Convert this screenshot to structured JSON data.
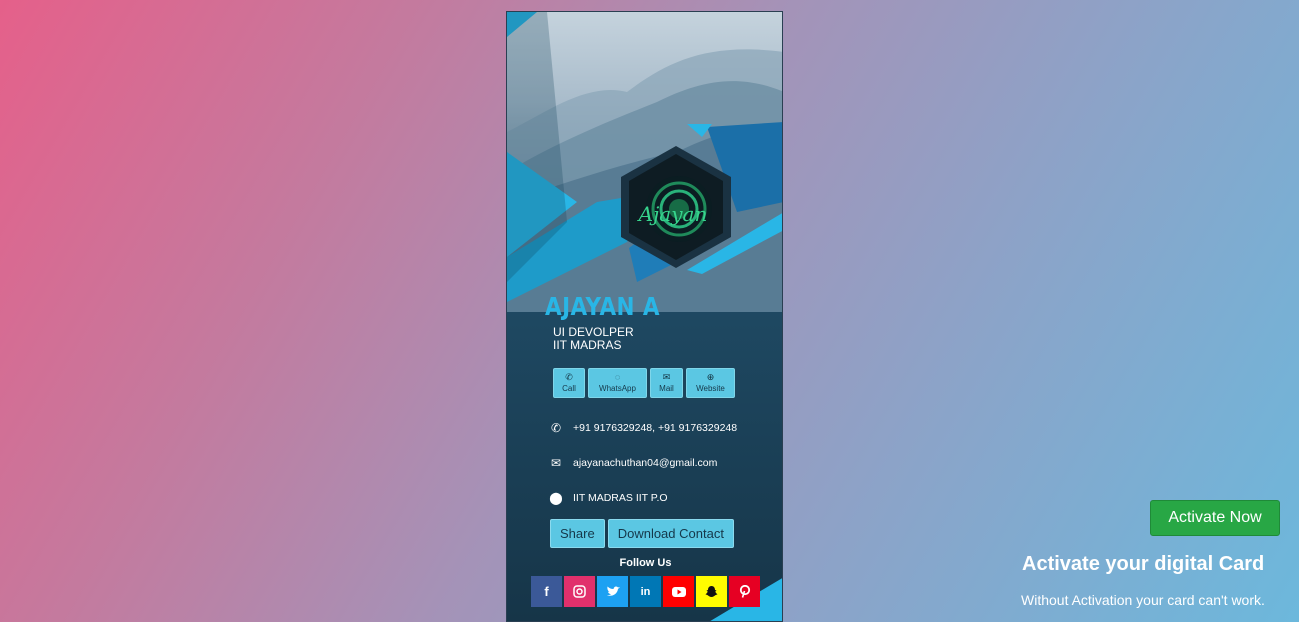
{
  "card": {
    "logo_text": "Ajayan",
    "name": "AJAYAN A",
    "role_line1": "UI DEVOLPER",
    "role_line2": "IIT MADRAS",
    "quick_buttons": [
      {
        "label": "Call",
        "icon": "phone-icon"
      },
      {
        "label": "WhatsApp",
        "icon": "whatsapp-icon"
      },
      {
        "label": "Mail",
        "icon": "mail-icon"
      },
      {
        "label": "Website",
        "icon": "globe-icon"
      }
    ],
    "phone": "+91 9176329248, +91 9176329248",
    "email": "ajayanachuthan04@gmail.com",
    "address": "IIT MADRAS IIT P.O",
    "share_label": "Share",
    "download_label": "Download Contact",
    "follow_label": "Follow Us",
    "socials": [
      {
        "name": "facebook",
        "glyph": "f",
        "color": "#3b5998"
      },
      {
        "name": "instagram",
        "glyph": "◎",
        "color": "#e1306c"
      },
      {
        "name": "twitter",
        "glyph": "🐦",
        "color": "#1da1f2"
      },
      {
        "name": "linkedin",
        "glyph": "in",
        "color": "#0077b5"
      },
      {
        "name": "youtube",
        "glyph": "▶",
        "color": "#ff0000"
      },
      {
        "name": "snapchat",
        "glyph": "👻",
        "color": "#fffc00"
      },
      {
        "name": "pinterest",
        "glyph": "P",
        "color": "#e60023"
      }
    ]
  },
  "activation": {
    "button_label": "Activate Now",
    "title": "Activate your digital Card",
    "subtitle": "Without Activation your card can't work."
  },
  "colors": {
    "accent": "#29b6e6",
    "button": "#5bc7e3",
    "activate": "#28a745"
  }
}
